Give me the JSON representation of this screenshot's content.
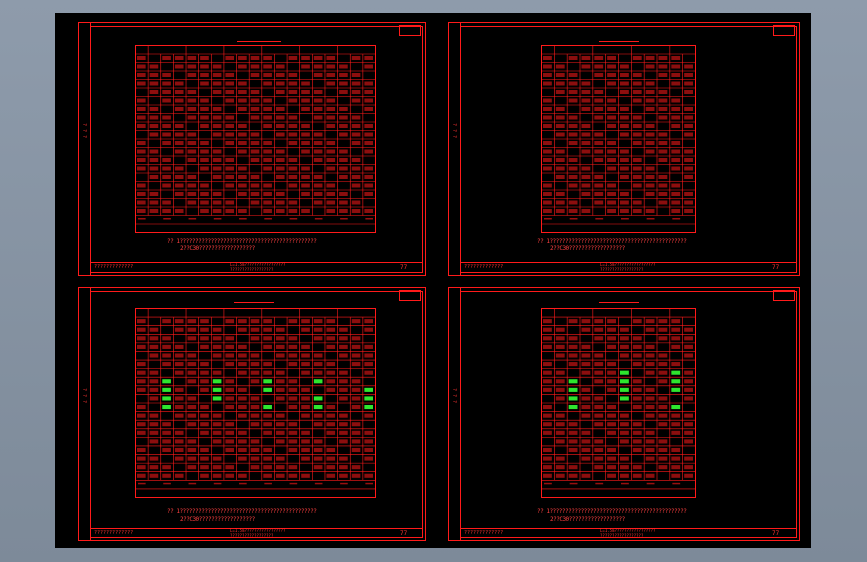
{
  "app": {
    "accent": "#ff1a1a",
    "canvas_bg": "#000000",
    "window_bg": "#8e9bab",
    "highlight": "#33ff33"
  },
  "sheets": [
    {
      "id": "top-left",
      "corner_label": "",
      "note_line1": "?? 1????????????????????????????????????????????",
      "note_line2": "2??C30??????????????????",
      "tb_left": "?????????????",
      "tb_mid_line1": "L=1.5m?????????????????",
      "tb_mid_line2": "??????????????????",
      "tb_right": "77"
    },
    {
      "id": "top-right",
      "corner_label": "",
      "note_line1": "?? 1????????????????????????????????????????????",
      "note_line2": "2??C30??????????????????",
      "tb_left": "?????????????",
      "tb_mid_line1": "L=1.5m?????????????????",
      "tb_mid_line2": "??????????????????",
      "tb_right": "77"
    },
    {
      "id": "bottom-left",
      "corner_label": "",
      "note_line1": "?? 1????????????????????????????????????????????",
      "note_line2": "2??C30??????????????????",
      "tb_left": "?????????????",
      "tb_mid_line1": "L=1.5m?????????????????",
      "tb_mid_line2": "??????????????????",
      "tb_right": "77"
    },
    {
      "id": "bottom-right",
      "corner_label": "",
      "note_line1": "?? 1????????????????????????????????????????????",
      "note_line2": "2??C30??????????????????",
      "tb_left": "?????????????",
      "tb_mid_line1": "L=1.5m?????????????????",
      "tb_mid_line2": "??????????????????",
      "tb_right": "77"
    }
  ]
}
